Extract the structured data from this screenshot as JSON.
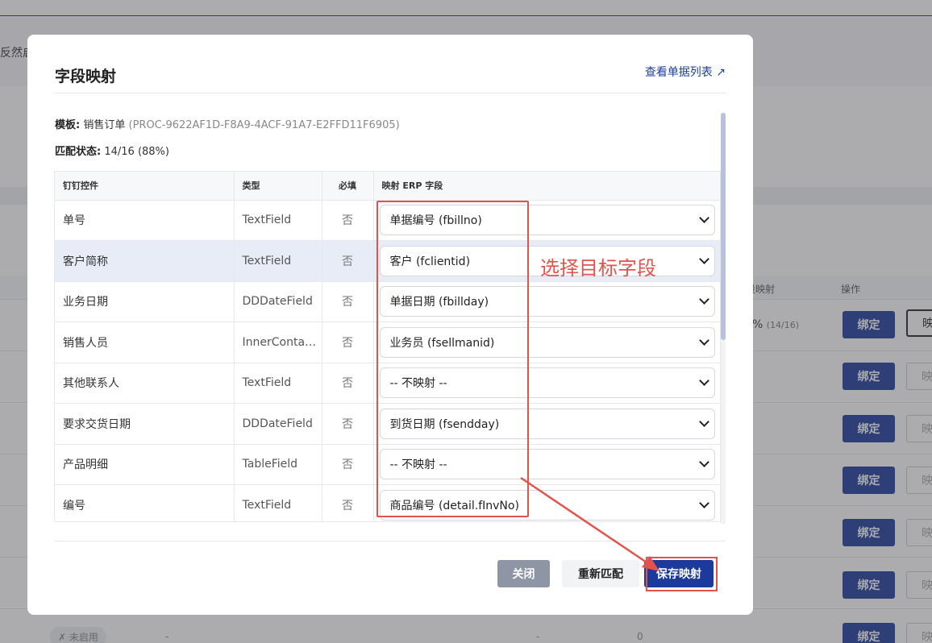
{
  "background": {
    "cut_text": "反然启",
    "table_headers": [
      "段映射",
      "操作"
    ],
    "row_progress": "%",
    "row_progress_detail": "(14/16)",
    "bind_label": "绑定",
    "map_label": "映",
    "status_tag": "✗ 未启用",
    "last_row_dashes": [
      "-",
      "-"
    ],
    "last_row_count": "0"
  },
  "modal": {
    "title": "字段映射",
    "view_link": "查看单据列表 ↗",
    "template_label": "模板:",
    "template_name": "销售订单",
    "template_id": "(PROC-9622AF1D-F8A9-4ACF-91A7-E2FFD11F6905)",
    "match_label": "匹配状态:",
    "match_value": "14/16 (88%)"
  },
  "table": {
    "headers": [
      "钉钉控件",
      "类型",
      "必填",
      "映射 ERP 字段"
    ],
    "rows": [
      {
        "control": "单号",
        "type": "TextField",
        "required": "否",
        "erp": "单据编号 (fbillno)"
      },
      {
        "control": "客户简称",
        "type": "TextField",
        "required": "否",
        "erp": "客户 (fclientid)"
      },
      {
        "control": "业务日期",
        "type": "DDDateField",
        "required": "否",
        "erp": "单据日期 (fbillday)"
      },
      {
        "control": "销售人员",
        "type": "InnerContac...",
        "required": "否",
        "erp": "业务员 (fsellmanid)"
      },
      {
        "control": "其他联系人",
        "type": "TextField",
        "required": "否",
        "erp": "-- 不映射 --"
      },
      {
        "control": "要求交货日期",
        "type": "DDDateField",
        "required": "否",
        "erp": "到货日期 (fsendday)"
      },
      {
        "control": "产品明细",
        "type": "TableField",
        "required": "否",
        "erp": "-- 不映射 --"
      },
      {
        "control": "编号",
        "type": "TextField",
        "required": "否",
        "erp": "商品编号 (detail.fInvNo)"
      }
    ]
  },
  "buttons": {
    "close": "关闭",
    "rematch": "重新匹配",
    "save": "保存映射"
  },
  "annotation": {
    "text": "选择目标字段",
    "color": "#e2544b"
  },
  "colors": {
    "primary": "#1b3a9b",
    "link": "#1d3f9a",
    "highlight_row": "#e8ecf7"
  }
}
